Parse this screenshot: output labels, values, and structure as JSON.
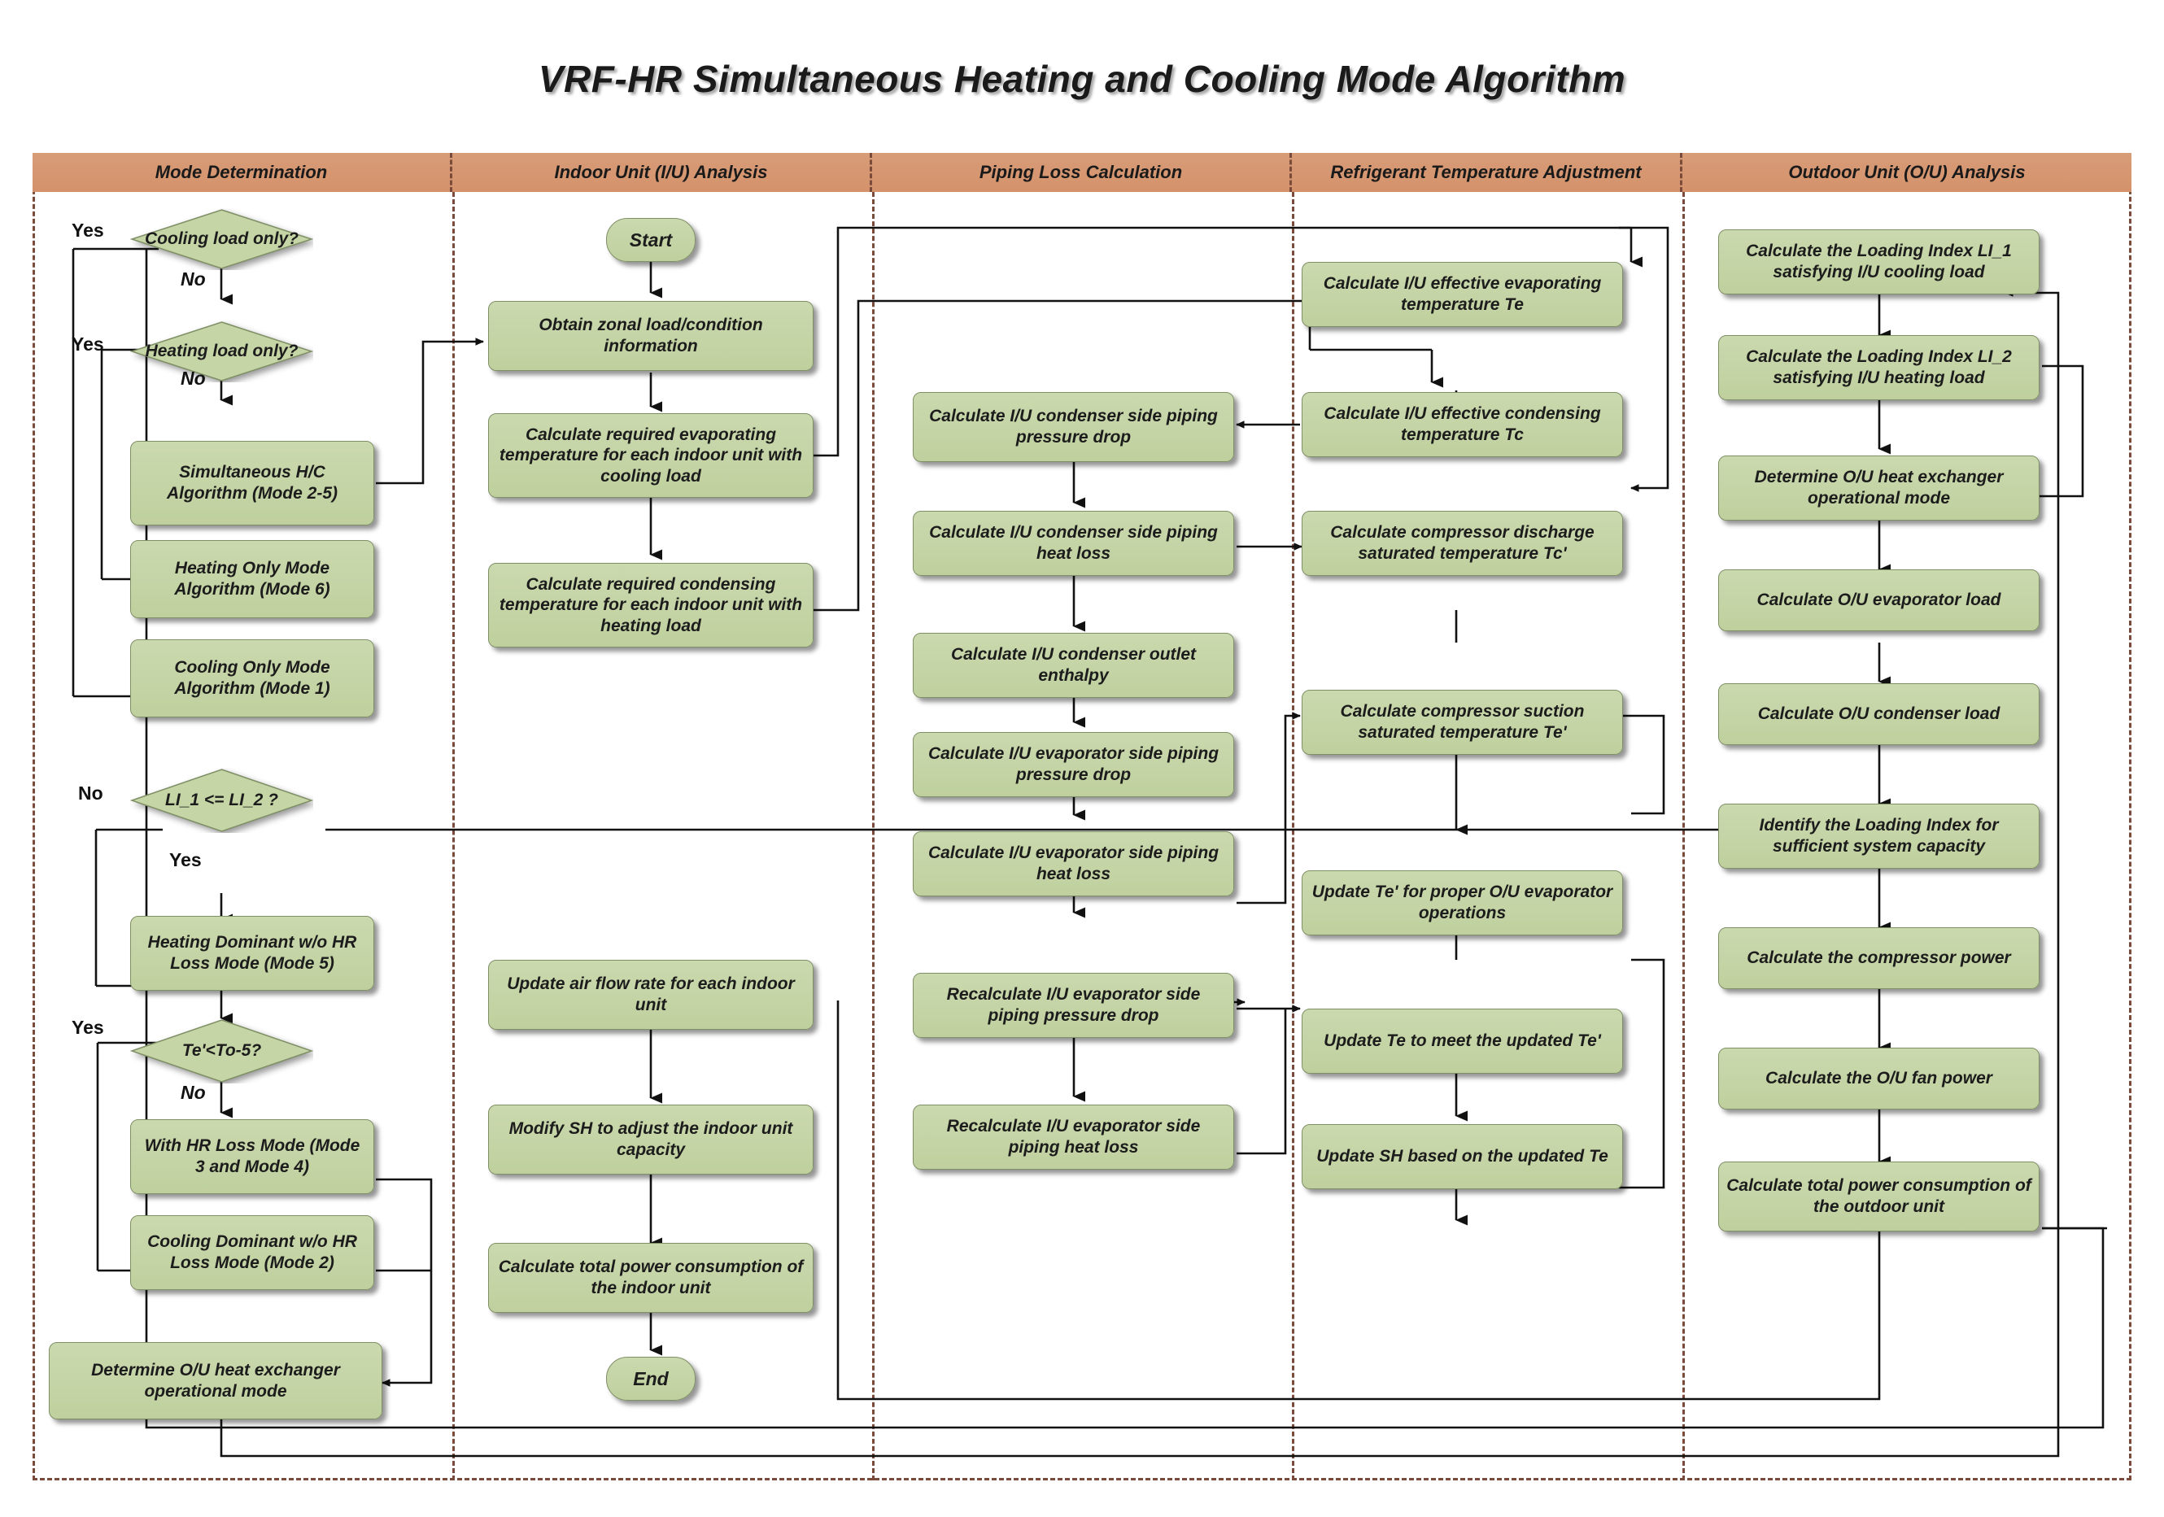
{
  "title": "VRF-HR Simultaneous Heating and Cooling Mode Algorithm",
  "colors": {
    "lane_header": "#d4926b",
    "lane_divider": "#7a4a3a",
    "node_fill": "#c5d5a5",
    "node_border": "#7f8f66",
    "connector": "#111111",
    "text": "#1c1c1c"
  },
  "lanes": [
    {
      "id": "mode",
      "label": "Mode Determination"
    },
    {
      "id": "iu",
      "label": "Indoor Unit (I/U) Analysis"
    },
    {
      "id": "piping",
      "label": "Piping Loss Calculation"
    },
    {
      "id": "refrigerant",
      "label": "Refrigerant Temperature Adjustment"
    },
    {
      "id": "ou",
      "label": "Outdoor Unit (O/U) Analysis"
    }
  ],
  "nodes": {
    "dec_cooling_only": "Cooling load only?",
    "dec_heating_only": "Heating load only?",
    "simultaneous_hc": "Simultaneous H/C Algorithm (Mode 2-5)",
    "heating_only_mode": "Heating Only Mode Algorithm (Mode 6)",
    "cooling_only_mode": "Cooling Only Mode Algorithm (Mode 1)",
    "dec_li": "LI_1 <= LI_2 ?",
    "heating_dominant": "Heating Dominant w/o HR Loss Mode (Mode 5)",
    "dec_te": "Te'<To-5?",
    "with_hr_loss": "With HR Loss Mode (Mode 3 and Mode 4)",
    "cooling_dominant": "Cooling Dominant w/o HR Loss Mode (Mode 2)",
    "determine_ou_mode_left": "Determine O/U heat exchanger operational mode",
    "start": "Start",
    "obtain_zonal": "Obtain zonal load/condition information",
    "calc_req_evap": "Calculate required evaporating temperature for each indoor unit with cooling load",
    "calc_req_cond": "Calculate required condensing temperature for each indoor unit with heating load",
    "update_airflow": "Update air flow rate for each indoor unit",
    "modify_sh": "Modify SH to adjust the indoor unit capacity",
    "calc_total_iu": "Calculate total power consumption of the indoor unit",
    "end": "End",
    "cond_press_drop": "Calculate I/U condenser side piping pressure drop",
    "cond_heat_loss": "Calculate I/U condenser side piping heat loss",
    "cond_outlet_enth": "Calculate I/U condenser outlet enthalpy",
    "evap_press_drop": "Calculate I/U evaporator side piping pressure drop",
    "evap_heat_loss": "Calculate I/U evaporator side piping heat loss",
    "re_evap_press_drop": "Recalculate I/U evaporator side piping pressure drop",
    "re_evap_heat_loss": "Recalculate I/U evaporator side piping heat loss",
    "calc_te": "Calculate I/U effective evaporating temperature Te",
    "calc_tc": "Calculate I/U effective condensing temperature Tc",
    "calc_tc_prime": "Calculate compressor discharge saturated temperature Tc'",
    "calc_te_prime": "Calculate compressor suction saturated temperature Te'",
    "update_te_prime": "Update Te' for proper O/U evaporator operations",
    "update_te": "Update Te to meet the updated Te'",
    "update_sh": "Update SH based on the updated Te",
    "calc_li1": "Calculate the Loading Index LI_1 satisfying I/U cooling load",
    "calc_li2": "Calculate the Loading Index LI_2 satisfying I/U heating load",
    "determine_ou_mode_right": "Determine O/U heat exchanger operational mode",
    "calc_ou_evap": "Calculate O/U evaporator load",
    "calc_ou_cond": "Calculate O/U condenser load",
    "identify_li": "Identify the Loading Index for sufficient system capacity",
    "calc_comp_power": "Calculate the compressor power",
    "calc_ou_fan": "Calculate the O/U fan power",
    "calc_total_ou": "Calculate total power consumption of the outdoor unit"
  },
  "edge_labels": {
    "cooling_yes": "Yes",
    "cooling_no": "No",
    "heating_yes": "Yes",
    "heating_no": "No",
    "li_no": "No",
    "li_yes": "Yes",
    "te_yes": "Yes",
    "te_no": "No"
  }
}
